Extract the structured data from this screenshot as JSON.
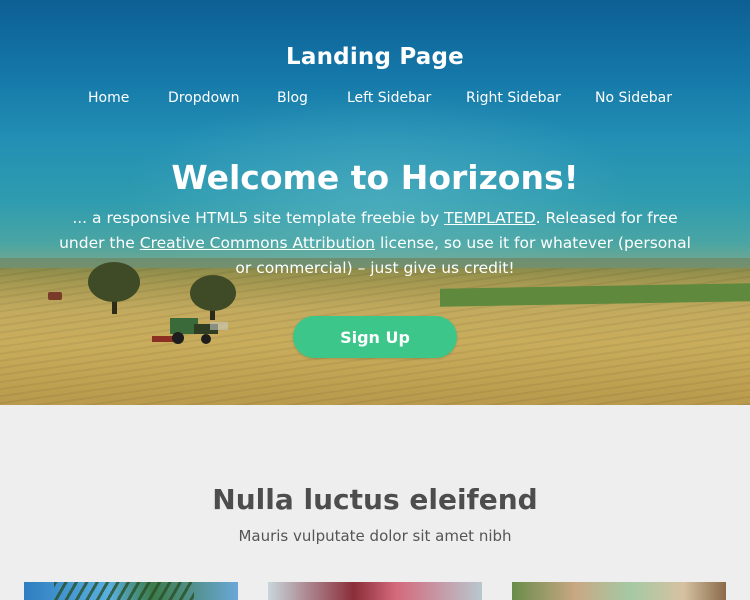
{
  "site": {
    "title": "Landing Page"
  },
  "nav": {
    "items": [
      "Home",
      "Dropdown",
      "Blog",
      "Left Sidebar",
      "Right Sidebar",
      "No Sidebar"
    ]
  },
  "hero": {
    "heading": "Welcome to Horizons!",
    "desc_part1": "... a responsive HTML5 site template freebie by ",
    "desc_link1": "TEMPLATED",
    "desc_part2": ". Released for free under the ",
    "desc_link2": "Creative Commons Attribution",
    "desc_part3": " license, so use it for whatever (personal or commercial) – just give us credit!",
    "button_label": "Sign Up"
  },
  "section": {
    "heading": "Nulla luctus eleifend",
    "subheading": "Mauris vulputate dolor sit amet nibh"
  },
  "colors": {
    "accent": "#3cc68a",
    "page_background": "#eeeeee",
    "heading_text": "#4d4d4d"
  }
}
